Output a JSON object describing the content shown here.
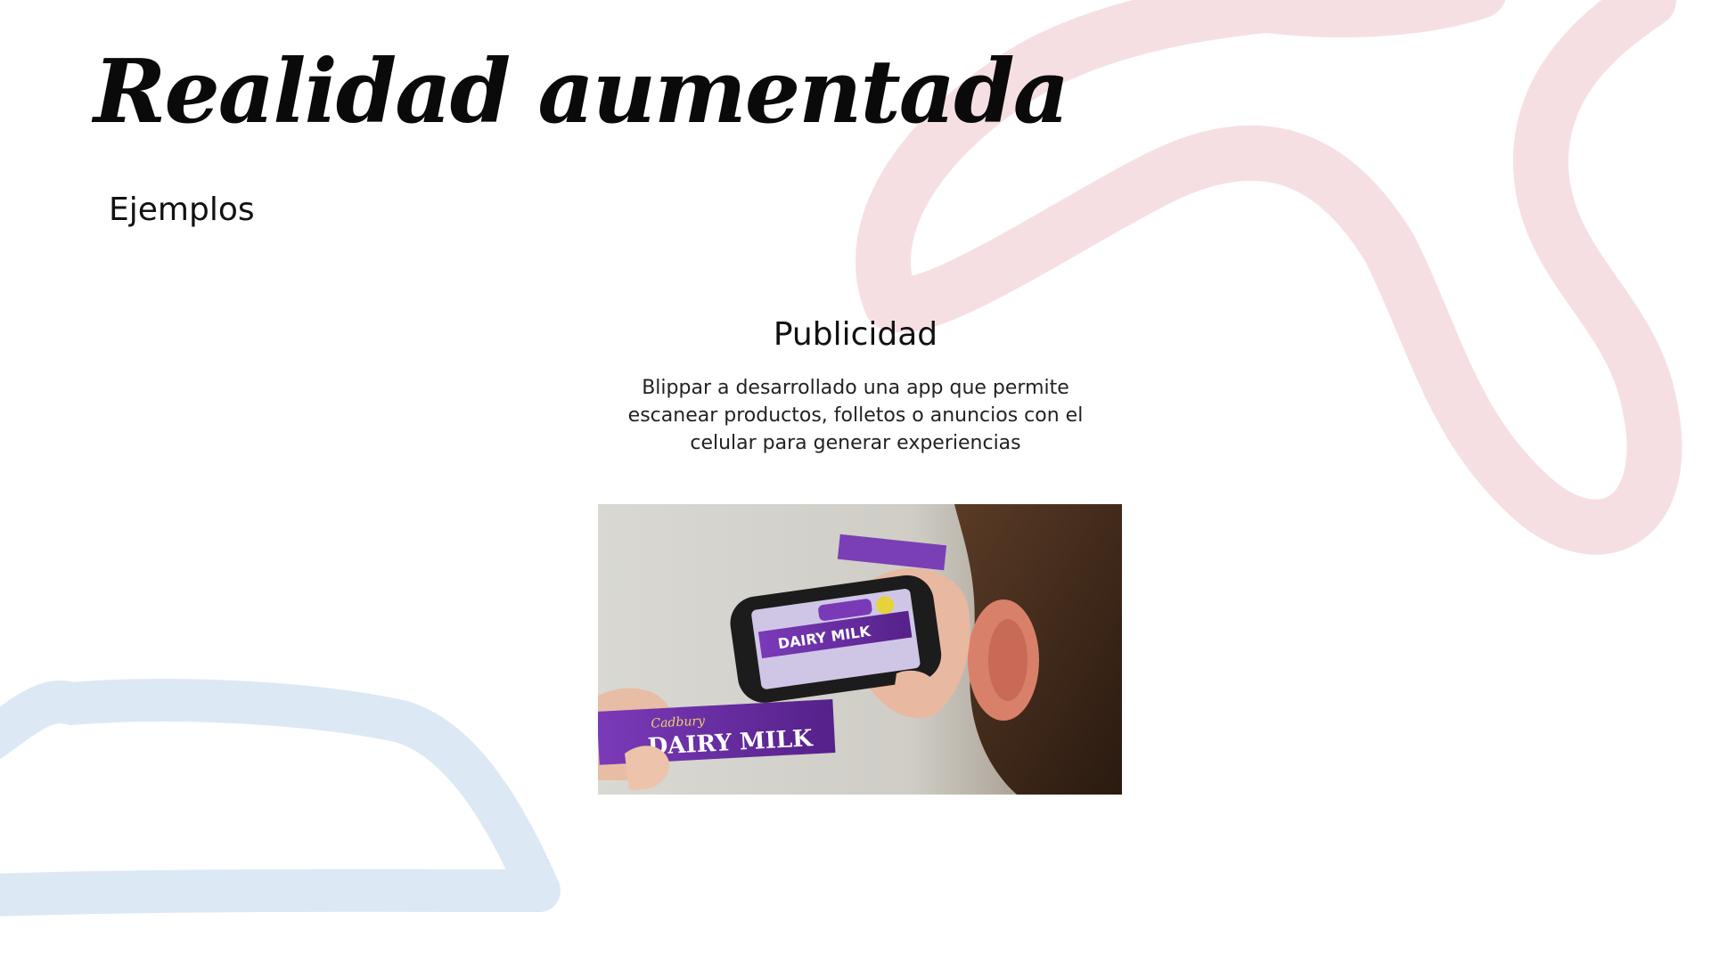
{
  "slide": {
    "title": "Realidad aumentada",
    "subtitle": "Ejemplos"
  },
  "section": {
    "heading": "Publicidad",
    "body": "Blippar a desarrollado una app que permite escanear productos, folletos o anuncios con el celular para generar experiencias"
  },
  "image": {
    "description_icon": "photo-ar-phone-scanning-chocolate-bar",
    "bar_brand": "Cadbury",
    "bar_name": "DAIRY MILK"
  },
  "colors": {
    "pink_decoration": "#f6dfe3",
    "blue_decoration": "#dde8f5",
    "purple_wrapper": "#6a2ca0"
  }
}
